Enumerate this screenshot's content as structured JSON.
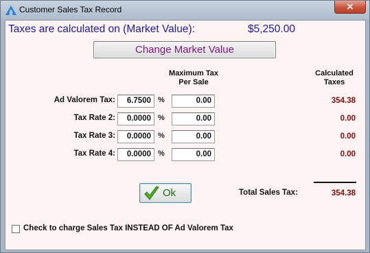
{
  "window": {
    "title": "Customer Sales Tax Record",
    "close_glyph": "×"
  },
  "header": {
    "text": "Taxes are calculated on (Market Value):",
    "market_value": "$5,250.00"
  },
  "change_button": {
    "label": "Change Market Value"
  },
  "columns": {
    "max_tax_line1": "Maximum Tax",
    "max_tax_line2": "Per Sale",
    "calc_line1": "Calculated",
    "calc_line2": "Taxes"
  },
  "rows": [
    {
      "label": "Ad Valorem Tax:",
      "rate": "6.7500",
      "pct": "%",
      "max_tax": "0.00",
      "calculated": "354.38"
    },
    {
      "label": "Tax Rate 2:",
      "rate": "0.0000",
      "pct": "%",
      "max_tax": "0.00",
      "calculated": "0.00"
    },
    {
      "label": "Tax Rate 3:",
      "rate": "0.0000",
      "pct": "%",
      "max_tax": "0.00",
      "calculated": "0.00"
    },
    {
      "label": "Tax Rate 4:",
      "rate": "0.0000",
      "pct": "%",
      "max_tax": "0.00",
      "calculated": "0.00"
    }
  ],
  "ok_button": {
    "label": "Ok"
  },
  "total": {
    "label": "Total Sales Tax:",
    "value": "354.38"
  },
  "sales_tax_checkbox": {
    "label": "Check to charge Sales Tax INSTEAD OF Ad Valorem Tax",
    "checked": false
  },
  "colors": {
    "header_text": "#1a1aa6",
    "calculated_text": "#7a1010",
    "change_button_text": "#7a1a7a",
    "client_background": "#fdf3f2"
  }
}
